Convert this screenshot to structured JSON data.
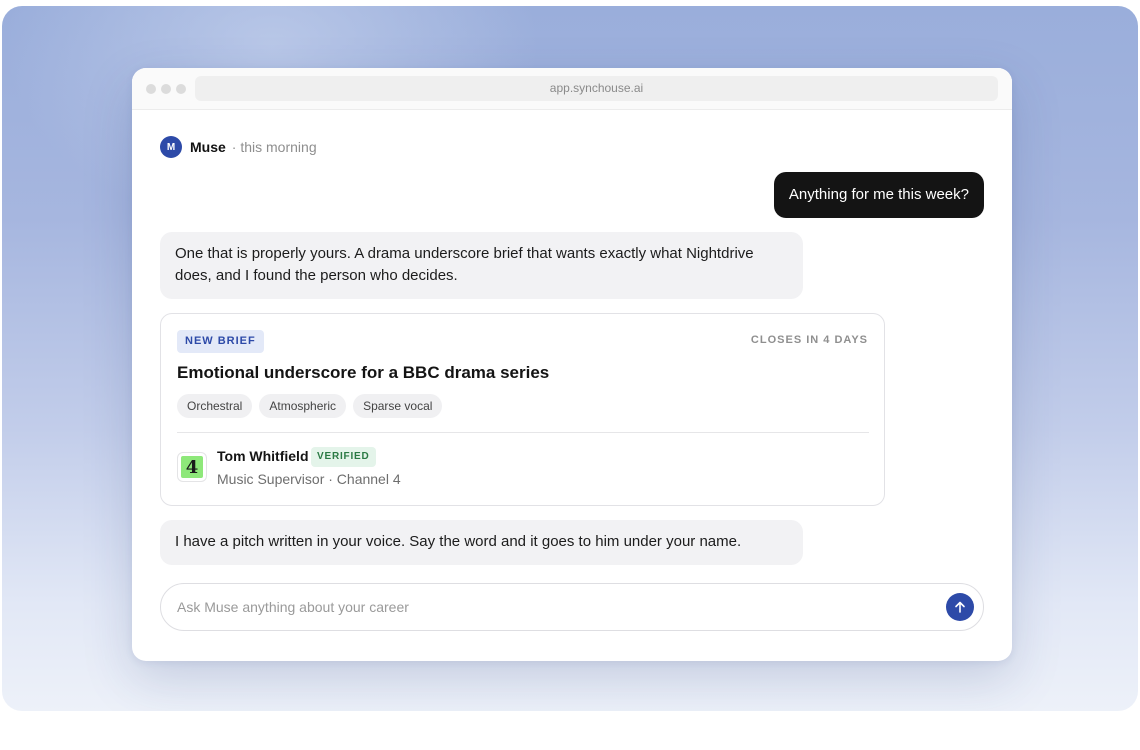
{
  "browser": {
    "url": "app.synchouse.ai"
  },
  "assistant": {
    "avatar_letter": "M",
    "name": "Muse",
    "time": "· this morning"
  },
  "user_message": "Anything for me this week?",
  "reply_1": "One that is properly yours. A drama underscore brief that wants exactly what Nightdrive does, and I found the person who decides.",
  "brief": {
    "badge": "NEW BRIEF",
    "closes": "CLOSES IN 4 DAYS",
    "title": "Emotional underscore for a BBC drama series",
    "tags": [
      "Orchestral",
      "Atmospheric",
      "Sparse vocal"
    ],
    "contact": {
      "logo_glyph": "4",
      "name": "Tom Whitfield",
      "verified": "VERIFIED",
      "role": "Music Supervisor · Channel 4"
    }
  },
  "reply_2": "I have a pitch written in your voice. Say the word and it goes to him under your name.",
  "composer": {
    "placeholder": "Ask Muse anything about your career",
    "send_icon": "arrow-up-icon"
  },
  "colors": {
    "accent": "#2d4aa8",
    "user_bubble": "#141414",
    "verified": "#2a7a44",
    "channel4_green": "#8ee87a"
  }
}
